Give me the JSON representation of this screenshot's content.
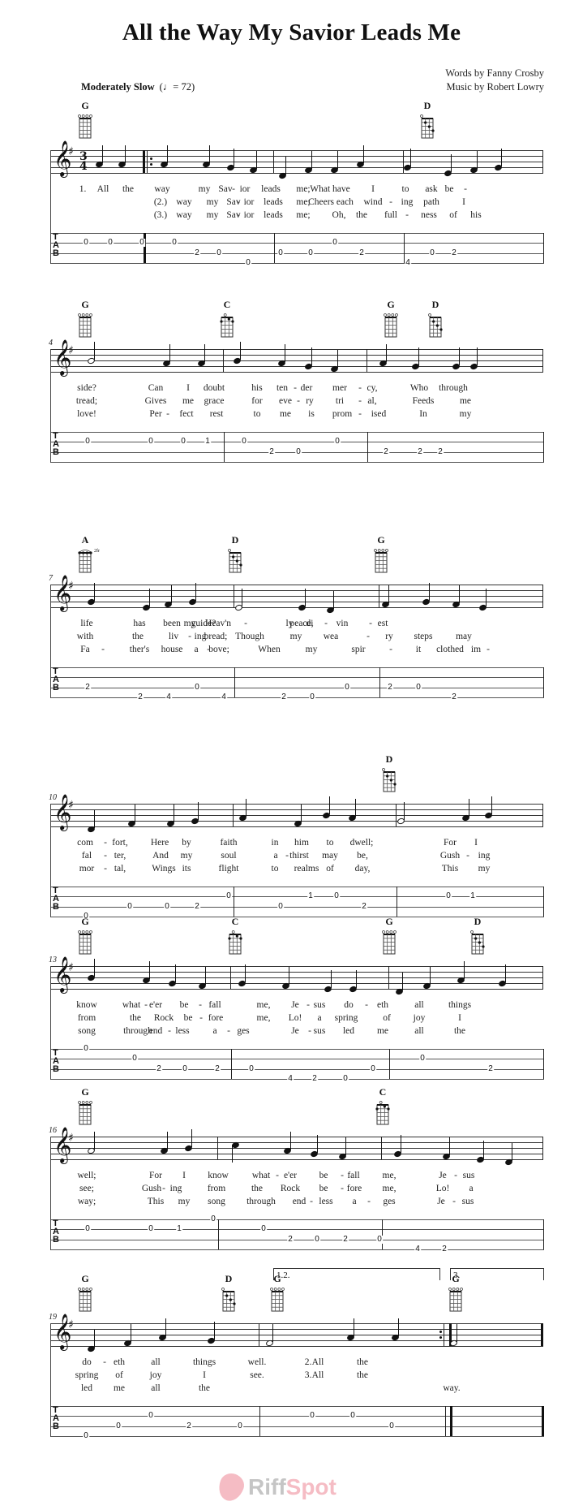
{
  "title": "All the Way My Savior Leads Me",
  "credits": {
    "words": "Words by Fanny Crosby",
    "music": "Music by Robert Lowry"
  },
  "tempo": {
    "label": "Moderately Slow",
    "metronome": "(♩= 72)"
  },
  "key_signature": "G major (1 sharp)",
  "time_signature": {
    "top": "3",
    "bottom": "4"
  },
  "clef_glyph": "𝄞",
  "sharp_glyph": "♯",
  "tab_label": {
    "t": "T",
    "a": "A",
    "b": "B"
  },
  "systems": [
    {
      "measure_number": "",
      "chords": [
        {
          "name": "G",
          "measure": 0
        },
        {
          "name": "D",
          "measure": 3
        }
      ],
      "lyrics": [
        [
          "1.",
          "All",
          "the",
          "way",
          "my",
          "Sav",
          "-",
          "ior",
          "leads",
          "me;",
          "What have",
          "I",
          "to",
          "ask",
          "be",
          "-"
        ],
        [
          "(2.)",
          "way",
          "my",
          "Sav",
          "-",
          "ior",
          "leads",
          "me;",
          "Cheers each",
          "wind",
          "-",
          "ing",
          "path",
          "I"
        ],
        [
          "(3.)",
          "way",
          "my",
          "Sav",
          "-",
          "ior",
          "leads",
          "me;",
          "Oh,",
          "the",
          "full",
          "-",
          "ness",
          "of",
          "his"
        ]
      ],
      "tab": [
        {
          "string": 1,
          "fret": "0"
        },
        {
          "string": 1,
          "fret": "0"
        },
        {
          "string": 1,
          "fret": "0"
        },
        {
          "string": 1,
          "fret": "0"
        },
        {
          "string": 2,
          "fret": "2"
        },
        {
          "string": 2,
          "fret": "0"
        },
        {
          "string": 3,
          "fret": "0"
        },
        {
          "string": 2,
          "fret": "0"
        },
        {
          "string": 2,
          "fret": "0"
        },
        {
          "string": 1,
          "fret": "0"
        },
        {
          "string": 2,
          "fret": "2"
        },
        {
          "string": 3,
          "fret": "4"
        },
        {
          "string": 2,
          "fret": "0"
        },
        {
          "string": 2,
          "fret": "2"
        }
      ]
    },
    {
      "measure_number": "4",
      "chords": [
        {
          "name": "G"
        },
        {
          "name": "C"
        },
        {
          "name": "G"
        },
        {
          "name": "D"
        }
      ],
      "lyrics": [
        [
          "side?",
          "Can",
          "I",
          "doubt",
          "his",
          "ten",
          "-",
          "der",
          "mer",
          "-",
          "cy,",
          "Who",
          "through"
        ],
        [
          "tread;",
          "Gives",
          "me",
          "grace",
          "for",
          "eve",
          "-",
          "ry",
          "tri",
          "-",
          "al,",
          "Feeds",
          "me"
        ],
        [
          "love!",
          "Per",
          "-",
          "fect",
          "rest",
          "to",
          "me",
          "is",
          "prom",
          "-",
          "ised",
          "In",
          "my"
        ]
      ],
      "tab": [
        {
          "string": 1,
          "fret": "0"
        },
        {
          "string": 1,
          "fret": "0"
        },
        {
          "string": 1,
          "fret": "0"
        },
        {
          "string": 1,
          "fret": "1"
        },
        {
          "string": 1,
          "fret": "0"
        },
        {
          "string": 2,
          "fret": "2"
        },
        {
          "string": 2,
          "fret": "0"
        },
        {
          "string": 1,
          "fret": "0"
        },
        {
          "string": 2,
          "fret": "2"
        },
        {
          "string": 2,
          "fret": "2"
        },
        {
          "string": 2,
          "fret": "2"
        }
      ]
    },
    {
      "measure_number": "7",
      "chords": [
        {
          "name": "A",
          "fret_label": "2fr"
        },
        {
          "name": "D"
        },
        {
          "name": "G"
        }
      ],
      "lyrics": [
        [
          "life",
          "has",
          "been",
          "my",
          "guide?",
          "Heav'n",
          "-",
          "ly",
          "peace,",
          "di",
          "-",
          "vin",
          "-",
          "est"
        ],
        [
          "with",
          "the",
          "liv",
          "-",
          "ing",
          "bread;",
          "Though",
          "my",
          "wea",
          "-",
          "ry",
          "steps",
          "may"
        ],
        [
          "Fa",
          "-",
          "ther's",
          "house",
          "a",
          "-",
          "bove;",
          "When",
          "my",
          "spir",
          "-",
          "it",
          "clothed",
          "im",
          "-"
        ]
      ],
      "tab": [
        {
          "string": 2,
          "fret": "2"
        },
        {
          "string": 3,
          "fret": "2"
        },
        {
          "string": 3,
          "fret": "4"
        },
        {
          "string": 2,
          "fret": "0"
        },
        {
          "string": 3,
          "fret": "4"
        },
        {
          "string": 3,
          "fret": "2"
        },
        {
          "string": 3,
          "fret": "0"
        },
        {
          "string": 2,
          "fret": "0"
        },
        {
          "string": 2,
          "fret": "2"
        },
        {
          "string": 2,
          "fret": "0"
        },
        {
          "string": 3,
          "fret": "2"
        }
      ]
    },
    {
      "measure_number": "10",
      "chords": [
        {
          "name": "D"
        }
      ],
      "lyrics": [
        [
          "com",
          "-",
          "fort,",
          "Here",
          "by",
          "faith",
          "in",
          "him",
          "to",
          "dwell;",
          "For",
          "I"
        ],
        [
          "fal",
          "-",
          "ter,",
          "And",
          "my",
          "soul",
          "a",
          "-",
          "thirst",
          "may",
          "be,",
          "Gush",
          "-",
          "ing"
        ],
        [
          "mor",
          "-",
          "tal,",
          "Wings",
          "its",
          "flight",
          "to",
          "realms",
          "of",
          "day,",
          "This",
          "my"
        ]
      ],
      "tab": [
        {
          "string": 3,
          "fret": "0"
        },
        {
          "string": 2,
          "fret": "0"
        },
        {
          "string": 2,
          "fret": "0"
        },
        {
          "string": 2,
          "fret": "2"
        },
        {
          "string": 1,
          "fret": "0"
        },
        {
          "string": 2,
          "fret": "0"
        },
        {
          "string": 1,
          "fret": "1"
        },
        {
          "string": 1,
          "fret": "0"
        },
        {
          "string": 2,
          "fret": "2"
        },
        {
          "string": 1,
          "fret": "0"
        },
        {
          "string": 1,
          "fret": "1"
        }
      ]
    },
    {
      "measure_number": "13",
      "chords": [
        {
          "name": "G"
        },
        {
          "name": "C"
        },
        {
          "name": "G"
        },
        {
          "name": "D"
        }
      ],
      "lyrics": [
        [
          "know",
          "what",
          "-",
          "e'er",
          "be",
          "-",
          "fall",
          "me,",
          "Je",
          "-",
          "sus",
          "do",
          "-",
          "eth",
          "all",
          "things"
        ],
        [
          "from",
          "the",
          "Rock",
          "be",
          "-",
          "fore",
          "me,",
          "Lo!",
          "a",
          "spring",
          "of",
          "joy",
          "I"
        ],
        [
          "song",
          "through",
          "end",
          "-",
          "less",
          "a",
          "-",
          "ges",
          "Je",
          "-",
          "sus",
          "led",
          "me",
          "all",
          "the"
        ]
      ],
      "tab": [
        {
          "string": 0,
          "fret": "0"
        },
        {
          "string": 1,
          "fret": "0"
        },
        {
          "string": 2,
          "fret": "2"
        },
        {
          "string": 2,
          "fret": "0"
        },
        {
          "string": 2,
          "fret": "2"
        },
        {
          "string": 2,
          "fret": "0"
        },
        {
          "string": 3,
          "fret": "4"
        },
        {
          "string": 3,
          "fret": "2"
        },
        {
          "string": 3,
          "fret": "0"
        },
        {
          "string": 2,
          "fret": "0"
        },
        {
          "string": 1,
          "fret": "0"
        },
        {
          "string": 2,
          "fret": "2"
        }
      ]
    },
    {
      "measure_number": "16",
      "chords": [
        {
          "name": "G"
        },
        {
          "name": "C"
        }
      ],
      "lyrics": [
        [
          "well;",
          "For",
          "I",
          "know",
          "what",
          "-",
          "e'er",
          "be",
          "-",
          "fall",
          "me,",
          "Je",
          "-",
          "sus"
        ],
        [
          "see;",
          "Gush",
          "-",
          "ing",
          "from",
          "the",
          "Rock",
          "be",
          "-",
          "fore",
          "me,",
          "Lo!",
          "a"
        ],
        [
          "way;",
          "This",
          "my",
          "song",
          "through",
          "end",
          "-",
          "less",
          "a",
          "-",
          "ges",
          "Je",
          "-",
          "sus"
        ]
      ],
      "tab": [
        {
          "string": 1,
          "fret": "0"
        },
        {
          "string": 1,
          "fret": "0"
        },
        {
          "string": 1,
          "fret": "1"
        },
        {
          "string": 0,
          "fret": "0"
        },
        {
          "string": 1,
          "fret": "0"
        },
        {
          "string": 2,
          "fret": "2"
        },
        {
          "string": 2,
          "fret": "0"
        },
        {
          "string": 2,
          "fret": "2"
        },
        {
          "string": 2,
          "fret": "0"
        },
        {
          "string": 3,
          "fret": "4"
        },
        {
          "string": 3,
          "fret": "2"
        }
      ]
    },
    {
      "measure_number": "19",
      "chords": [
        {
          "name": "G"
        },
        {
          "name": "D"
        },
        {
          "name": "G"
        },
        {
          "name": "G"
        }
      ],
      "voltas": [
        {
          "label": "1.2."
        },
        {
          "label": "3."
        }
      ],
      "lyrics": [
        [
          "do",
          "-",
          "eth",
          "all",
          "things",
          "well.",
          "2.",
          "All",
          "the"
        ],
        [
          "spring",
          "of",
          "joy",
          "I",
          "see.",
          "3.",
          "All",
          "the"
        ],
        [
          "led",
          "me",
          "all",
          "the",
          "way."
        ]
      ],
      "tab": [
        {
          "string": 3,
          "fret": "0"
        },
        {
          "string": 2,
          "fret": "0"
        },
        {
          "string": 1,
          "fret": "0"
        },
        {
          "string": 2,
          "fret": "2"
        },
        {
          "string": 2,
          "fret": "0"
        },
        {
          "string": 1,
          "fret": "0"
        },
        {
          "string": 1,
          "fret": "0"
        },
        {
          "string": 2,
          "fret": "0"
        }
      ]
    }
  ],
  "watermark": {
    "part1": "Riff",
    "part2": "Spot"
  },
  "colors": {
    "watermark_pink": "#f4b5be",
    "watermark_gray": "#bfbfbf"
  }
}
